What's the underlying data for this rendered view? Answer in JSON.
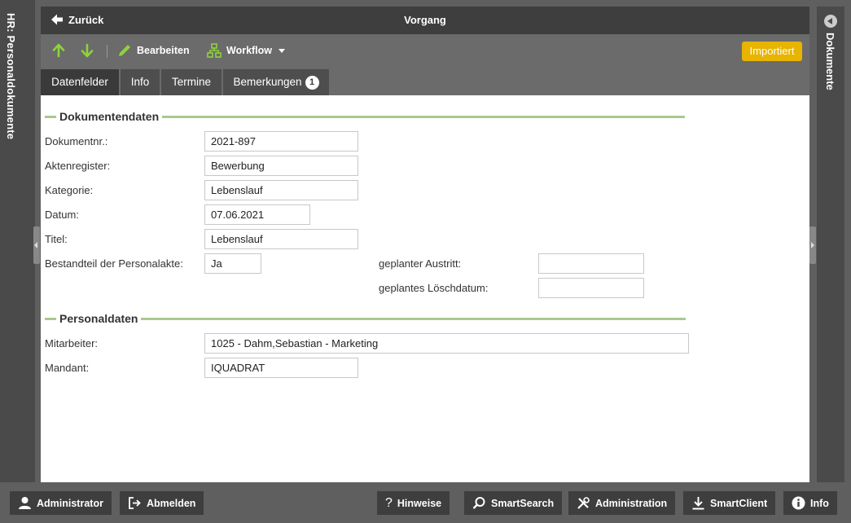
{
  "left_panel": {
    "label": "HR: Personaldokumente"
  },
  "right_panel": {
    "label": "Dokumente"
  },
  "titlebar": {
    "back_label": "Zurück",
    "title": "Vorgang"
  },
  "toolbar": {
    "edit_label": "Bearbeiten",
    "workflow_label": "Workflow",
    "status_badge": "Importiert",
    "accent_color": "#8ed33c",
    "badge_color": "#e8b400"
  },
  "tabs": [
    {
      "label": "Datenfelder",
      "active": true
    },
    {
      "label": "Info"
    },
    {
      "label": "Termine"
    },
    {
      "label": "Bemerkungen",
      "count": "1"
    }
  ],
  "sections": {
    "dokumentendaten": {
      "title": "Dokumentendaten",
      "fields": {
        "dokumentnr": {
          "label": "Dokumentnr.:",
          "value": "2021-897"
        },
        "aktenregister": {
          "label": "Aktenregister:",
          "value": "Bewerbung"
        },
        "kategorie": {
          "label": "Kategorie:",
          "value": "Lebenslauf"
        },
        "datum": {
          "label": "Datum:",
          "value": "07.06.2021"
        },
        "titel": {
          "label": "Titel:",
          "value": "Lebenslauf"
        },
        "bestandteil": {
          "label": "Bestandteil der Personalakte:",
          "value": "Ja"
        },
        "austritt": {
          "label": "geplanter Austritt:",
          "value": ""
        },
        "loeschdatum": {
          "label": "geplantes Löschdatum:",
          "value": ""
        }
      }
    },
    "personaldaten": {
      "title": "Personaldaten",
      "fields": {
        "mitarbeiter": {
          "label": "Mitarbeiter:",
          "value": "1025 - Dahm,Sebastian - Marketing"
        },
        "mandant": {
          "label": "Mandant:",
          "value": "IQUADRAT"
        }
      }
    }
  },
  "footer": {
    "administrator": "Administrator",
    "abmelden": "Abmelden",
    "hinweise": "Hinweise",
    "smartsearch": "SmartSearch",
    "administration": "Administration",
    "smartclient": "SmartClient",
    "info": "Info"
  }
}
